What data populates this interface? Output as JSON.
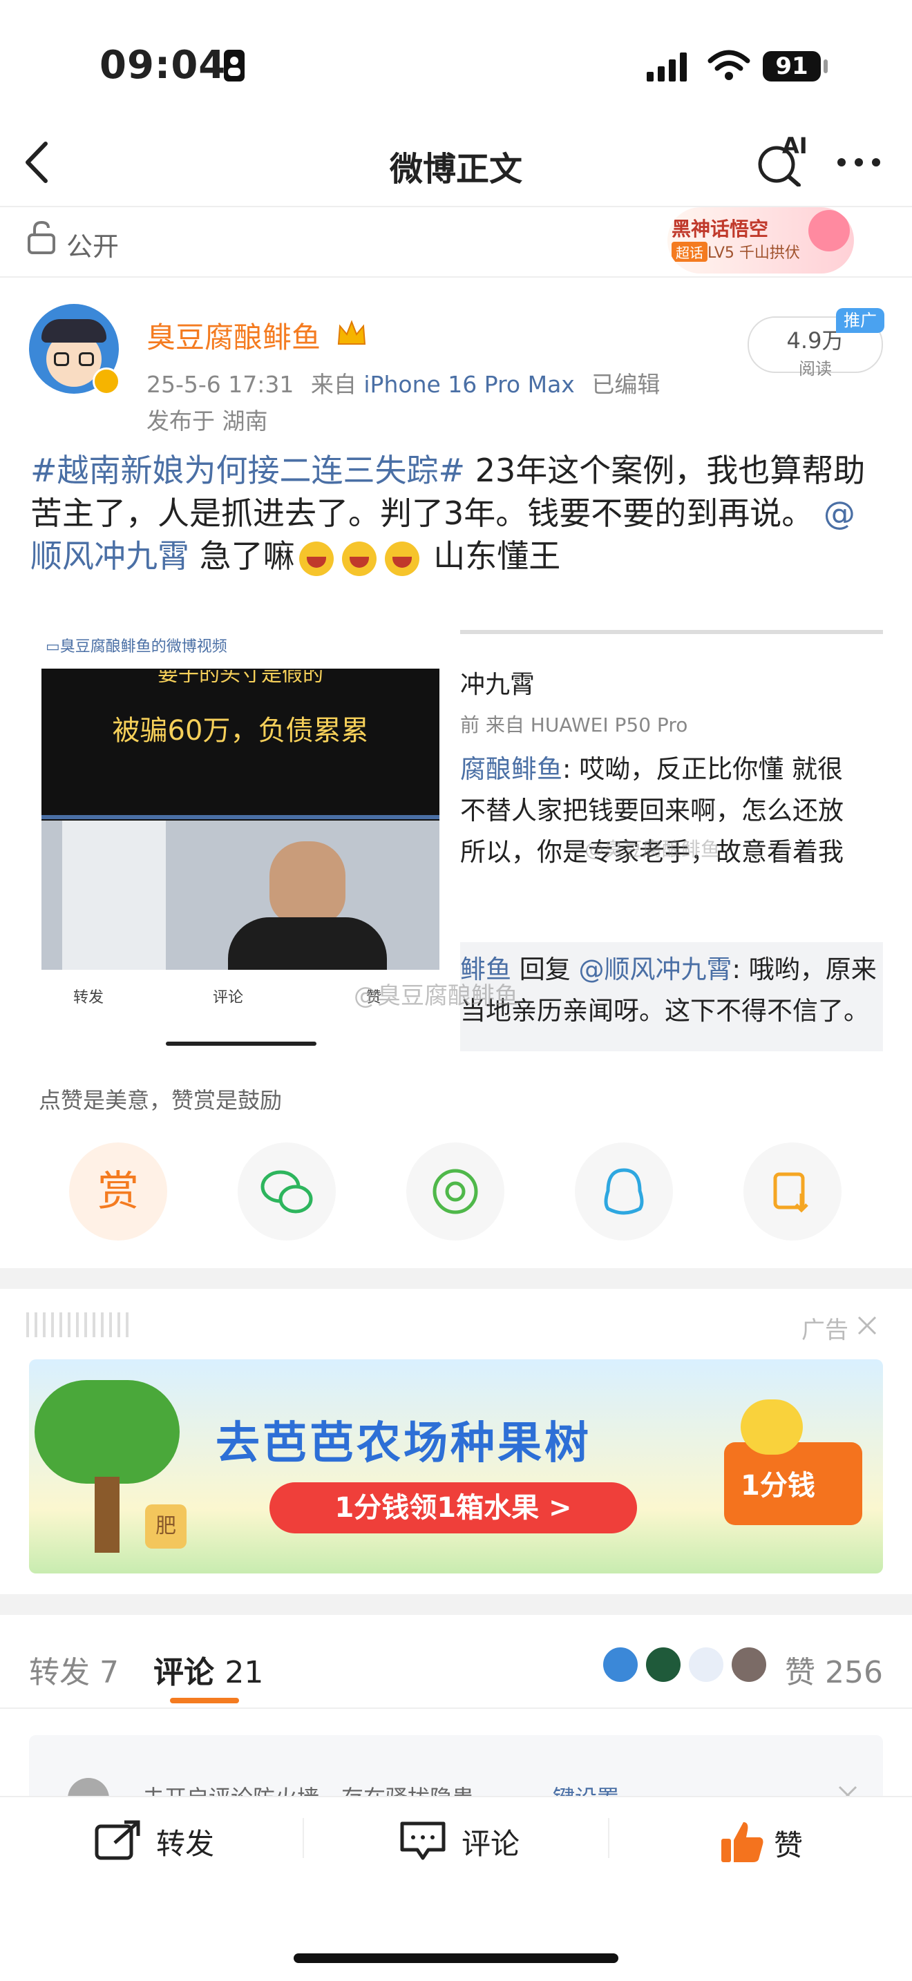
{
  "status_bar": {
    "time": "09:04",
    "battery": "91"
  },
  "nav": {
    "title": "微博正文",
    "ai_label": "AI"
  },
  "visibility": {
    "label": "公开"
  },
  "top_badge": {
    "title": "黑神话悟空",
    "tag": "超话",
    "level": "LV5 千山拱伏"
  },
  "post": {
    "username": "臭豆腐酿鲱鱼",
    "time": "25-5-6 17:31",
    "source_prefix": "来自",
    "device": "iPhone 16 Pro Max",
    "edited": "已编辑",
    "location": "发布于 湖南",
    "read_count": "4.9万",
    "read_label": "阅读",
    "promo_label": "推广",
    "text": {
      "hashtag": "#越南新娘为何接二连三失踪#",
      "body1": " 23年这个案例，我也算帮助苦主了，人是抓进去了。判了3年。钱要不要的到再说。",
      "mention": "@顺风冲九霄",
      "body2": " 急了嘛",
      "body3": " 山东懂王"
    }
  },
  "media": {
    "video_label": "▭臭豆腐酿鲱鱼的微博视频",
    "video_caption_top": "要子的头寸是假的",
    "video_caption": "被骗60万，负债累累",
    "video_actions": [
      "转发",
      "评论",
      "赞"
    ],
    "shot_name": "冲九霄",
    "shot_meta": "前  来自 HUAWEI P50 Pro",
    "shot_line1_user": "腐酿鲱鱼",
    "shot_line1": ": 哎呦，反正比你懂 就很",
    "shot_line2": "不替人家把钱要回来啊，怎么还放",
    "shot_line3": "所以，你是专家老手，故意看着我",
    "shot_reply_user": "鲱鱼",
    "shot_reply_word": " 回复 ",
    "shot_reply_mention": "@顺风冲九霄",
    "shot_reply_text": ": 哦哟，原来",
    "shot_line5": "当地亲历亲闻呀。这下不得不信了。",
    "watermark1": "@臭豆腐酿鲱鱼",
    "watermark2": "@臭豆腐酿鲱鱼"
  },
  "reward": {
    "hint": "点赞是美意，赞赏是鼓励",
    "reward_label": "赏"
  },
  "ad": {
    "label": "广告",
    "headline": "去芭芭农场种果树",
    "cta": "1分钱领1箱水果 >",
    "badge": "1分钱",
    "pot_label": "肥"
  },
  "tabs": {
    "repost": "转发 7",
    "comment_label": "评论",
    "comment_count": "21",
    "like_label": "赞",
    "like_count": "256"
  },
  "notice": {
    "text": "未开启评论防火墙，存在骚扰隐患",
    "link": "一键设置"
  },
  "bottom": {
    "repost": "转发",
    "comment": "评论",
    "like": "赞"
  },
  "colors": {
    "accent": "#f47b20",
    "link": "#4a6fa5",
    "like": "#f4731e"
  }
}
